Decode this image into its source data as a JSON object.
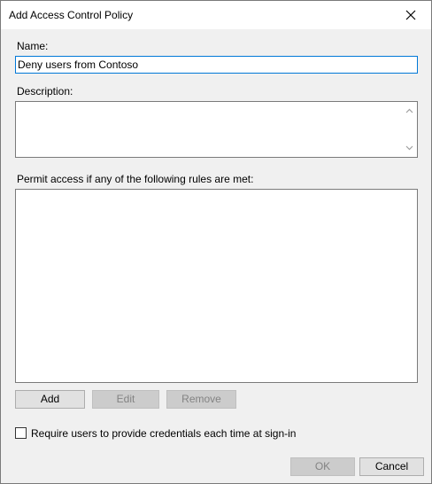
{
  "dialog": {
    "title": "Add Access Control Policy",
    "close_icon": "close-icon"
  },
  "form": {
    "name_label": "Name:",
    "name_value": "Deny users from Contoso",
    "description_label": "Description:",
    "description_value": "",
    "rules_label": "Permit access if any of the following rules are met:",
    "rules_items": []
  },
  "rule_buttons": {
    "add": "Add",
    "edit": "Edit",
    "remove": "Remove"
  },
  "options": {
    "require_credentials_label": "Require users to provide credentials each time at sign-in",
    "require_credentials_checked": false
  },
  "footer": {
    "ok": "OK",
    "cancel": "Cancel"
  },
  "colors": {
    "accent": "#0078d7",
    "dialog_bg": "#f0f0f0",
    "disabled_text": "#838383"
  }
}
